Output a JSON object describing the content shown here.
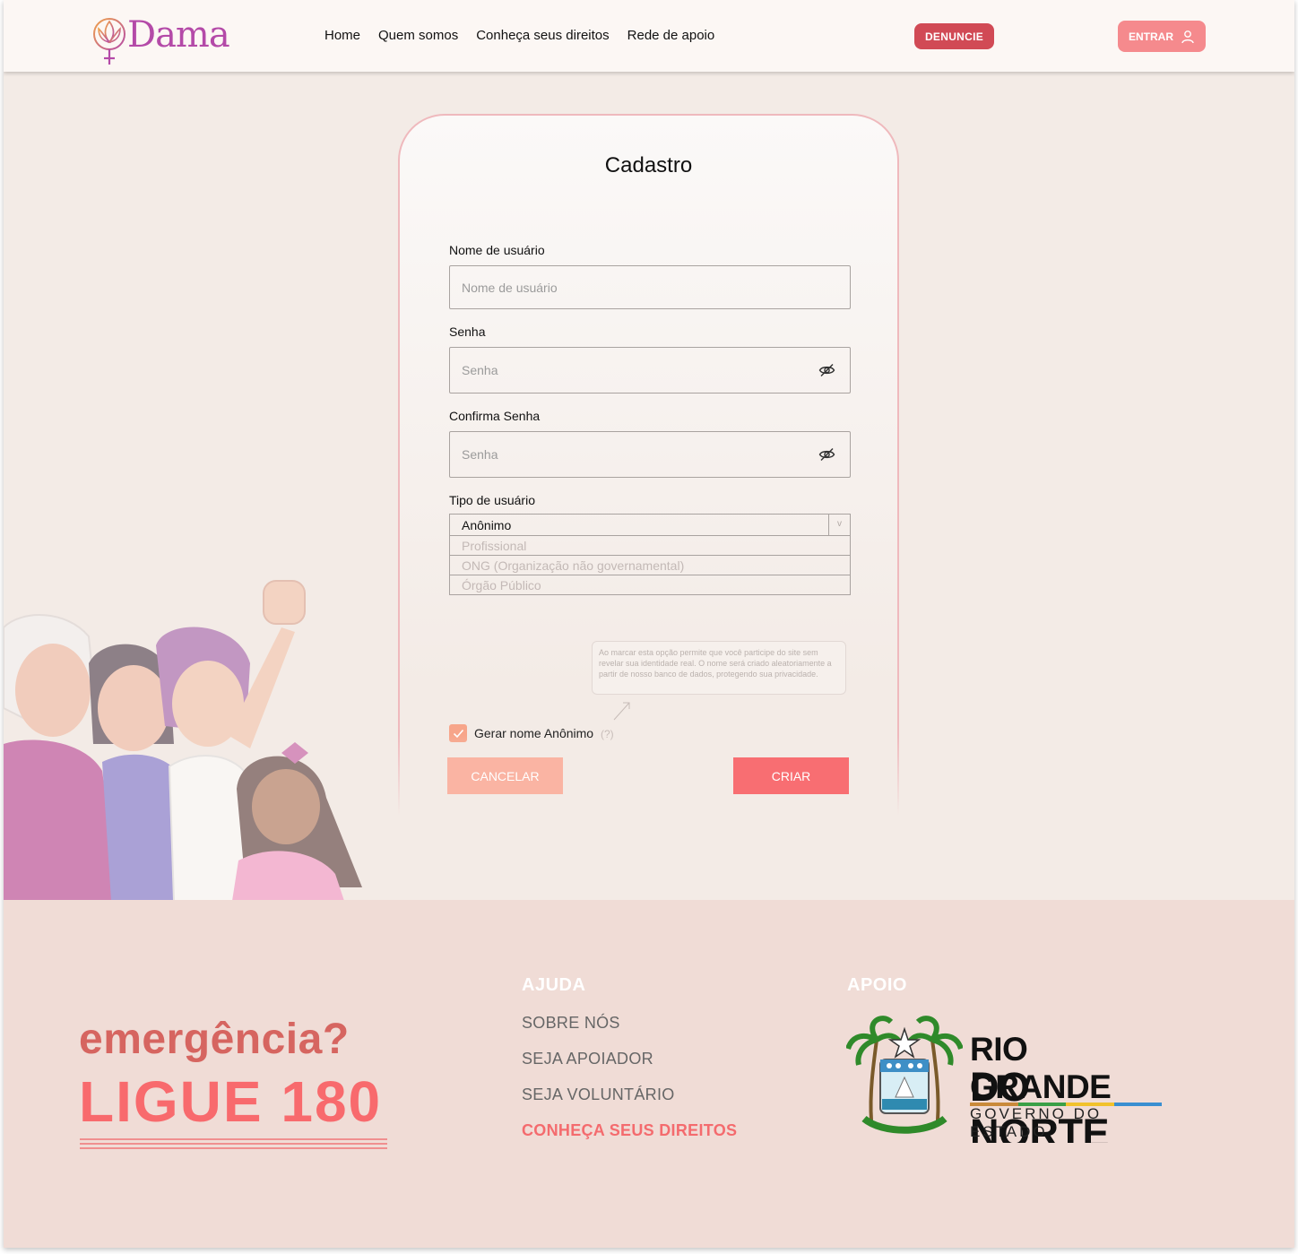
{
  "header": {
    "logo_text": "Dama",
    "nav": [
      "Home",
      "Quem somos",
      "Conheça seus direitos",
      "Rede de apoio"
    ],
    "denuncie_label": "DENUNCIE",
    "entrar_label": "ENTRAR"
  },
  "form": {
    "title": "Cadastro",
    "username": {
      "label": "Nome de usuário",
      "placeholder": "Nome de usuário"
    },
    "password": {
      "label": "Senha",
      "placeholder": "Senha"
    },
    "confirm": {
      "label": "Confirma Senha",
      "placeholder": "Senha"
    },
    "user_type": {
      "label": "Tipo de usuário",
      "selected": "Anônimo",
      "options": [
        "Profissional",
        "ONG (Organização não governamental)",
        "Órgão Público"
      ]
    },
    "tooltip": "Ao marcar esta opção permite que você participe do site sem revelar sua identidade real. O nome será criado aleatoriamente a partir de nosso banco de dados, protegendo sua privacidade.",
    "anon_checkbox": {
      "label": "Gerar nome Anônimo",
      "help": "(?)",
      "checked": true
    },
    "cancel_label": "CANCELAR",
    "create_label": "CRIAR"
  },
  "footer": {
    "emergency": "emergência?",
    "call": "LIGUE 180",
    "help_heading": "AJUDA",
    "help_links": [
      "SOBRE NÓS",
      "SEJA APOIADOR",
      "SEJA VOLUNTÁRIO"
    ],
    "help_accent_link": "CONHEÇA SEUS DIREITOS",
    "support_heading": "APOIO",
    "gov_line1": "RIO GRANDE",
    "gov_line2": "DO NORTE",
    "gov_line3": "GOVERNO DO ESTADO"
  },
  "colors": {
    "brand": "#b44aa8",
    "denuncie": "#d14a55",
    "entrar": "#f58a8d",
    "criar": "#f86e72",
    "cancelar": "#fab4a3",
    "footer_bg": "#f0dcd6",
    "page_bg": "#f3ebe6"
  },
  "icons": [
    "lotus-venus-logo-icon",
    "user-icon",
    "eye-off-icon",
    "chevron-down-icon",
    "check-icon",
    "arrow-icon"
  ]
}
